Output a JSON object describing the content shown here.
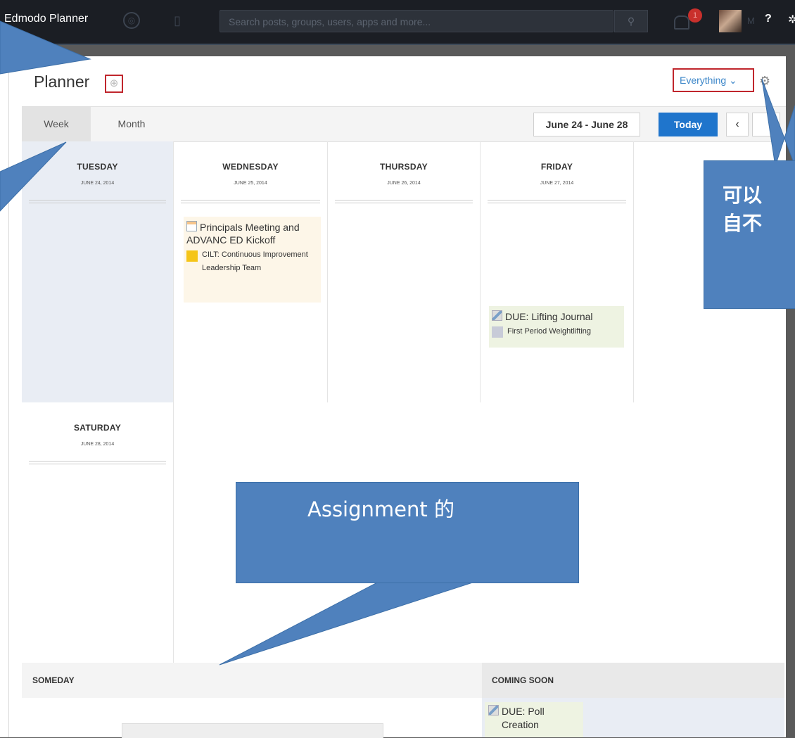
{
  "nav": {
    "brand": "Edmodo Planner",
    "search_placeholder": "Search posts, groups, users, apps and more...",
    "notification_count": "1",
    "user_initials": "M",
    "help_label": "?"
  },
  "planner": {
    "title": "Planner",
    "add_label": "⊕",
    "filter_label": "Everything ⌄"
  },
  "toolbar": {
    "tabs": [
      "Week",
      "Month"
    ],
    "active_tab": "Week",
    "date_range": "June 24 - June 28",
    "today_label": "Today",
    "prev_label": "‹"
  },
  "days": [
    {
      "name": "TUESDAY",
      "date": "JUNE 24, 2014"
    },
    {
      "name": "WEDNESDAY",
      "date": "JUNE 25, 2014"
    },
    {
      "name": "THURSDAY",
      "date": "JUNE 26, 2014"
    },
    {
      "name": "FRIDAY",
      "date": "JUNE 27, 2014"
    },
    {
      "name": "SATURDAY",
      "date": "JUNE 28, 2014"
    }
  ],
  "events": {
    "wednesday": {
      "title": "Principals Meeting and ADVANC ED Kickoff",
      "group": "CILT: Continuous Improvement Leadership Team",
      "group_color": "#f5c518"
    },
    "friday": {
      "title": "DUE: Lifting Journal",
      "group": "First Period Weightlifting",
      "group_color": "#c8cbd8"
    }
  },
  "sections": {
    "someday": "SOMEDAY",
    "coming_soon": "COMING SOON",
    "coming_item_title": "DUE: Poll",
    "coming_item_sub": "Creation"
  },
  "callouts": {
    "right_line1": "可以",
    "right_line2": "自不",
    "bottom": "Assignment 的"
  },
  "colors": {
    "accent": "#1f75cc",
    "callout": "#4f81bd",
    "highlight_border": "#c0262d"
  }
}
